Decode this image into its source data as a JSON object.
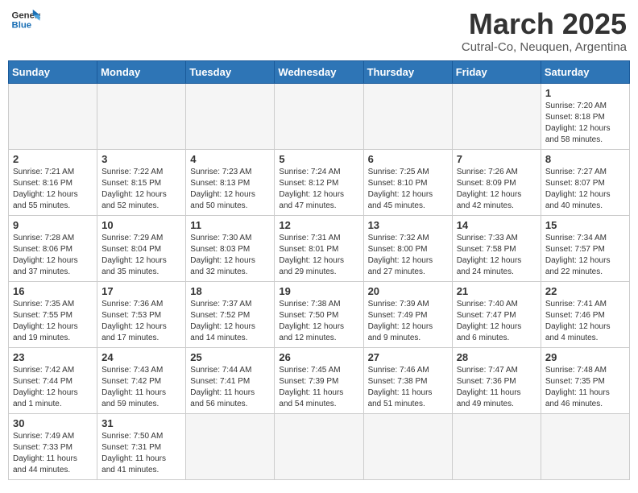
{
  "header": {
    "logo_general": "General",
    "logo_blue": "Blue",
    "main_title": "March 2025",
    "subtitle": "Cutral-Co, Neuquen, Argentina"
  },
  "weekdays": [
    "Sunday",
    "Monday",
    "Tuesday",
    "Wednesday",
    "Thursday",
    "Friday",
    "Saturday"
  ],
  "weeks": [
    [
      {
        "day": "",
        "info": ""
      },
      {
        "day": "",
        "info": ""
      },
      {
        "day": "",
        "info": ""
      },
      {
        "day": "",
        "info": ""
      },
      {
        "day": "",
        "info": ""
      },
      {
        "day": "",
        "info": ""
      },
      {
        "day": "1",
        "info": "Sunrise: 7:20 AM\nSunset: 8:18 PM\nDaylight: 12 hours\nand 58 minutes."
      }
    ],
    [
      {
        "day": "2",
        "info": "Sunrise: 7:21 AM\nSunset: 8:16 PM\nDaylight: 12 hours\nand 55 minutes."
      },
      {
        "day": "3",
        "info": "Sunrise: 7:22 AM\nSunset: 8:15 PM\nDaylight: 12 hours\nand 52 minutes."
      },
      {
        "day": "4",
        "info": "Sunrise: 7:23 AM\nSunset: 8:13 PM\nDaylight: 12 hours\nand 50 minutes."
      },
      {
        "day": "5",
        "info": "Sunrise: 7:24 AM\nSunset: 8:12 PM\nDaylight: 12 hours\nand 47 minutes."
      },
      {
        "day": "6",
        "info": "Sunrise: 7:25 AM\nSunset: 8:10 PM\nDaylight: 12 hours\nand 45 minutes."
      },
      {
        "day": "7",
        "info": "Sunrise: 7:26 AM\nSunset: 8:09 PM\nDaylight: 12 hours\nand 42 minutes."
      },
      {
        "day": "8",
        "info": "Sunrise: 7:27 AM\nSunset: 8:07 PM\nDaylight: 12 hours\nand 40 minutes."
      }
    ],
    [
      {
        "day": "9",
        "info": "Sunrise: 7:28 AM\nSunset: 8:06 PM\nDaylight: 12 hours\nand 37 minutes."
      },
      {
        "day": "10",
        "info": "Sunrise: 7:29 AM\nSunset: 8:04 PM\nDaylight: 12 hours\nand 35 minutes."
      },
      {
        "day": "11",
        "info": "Sunrise: 7:30 AM\nSunset: 8:03 PM\nDaylight: 12 hours\nand 32 minutes."
      },
      {
        "day": "12",
        "info": "Sunrise: 7:31 AM\nSunset: 8:01 PM\nDaylight: 12 hours\nand 29 minutes."
      },
      {
        "day": "13",
        "info": "Sunrise: 7:32 AM\nSunset: 8:00 PM\nDaylight: 12 hours\nand 27 minutes."
      },
      {
        "day": "14",
        "info": "Sunrise: 7:33 AM\nSunset: 7:58 PM\nDaylight: 12 hours\nand 24 minutes."
      },
      {
        "day": "15",
        "info": "Sunrise: 7:34 AM\nSunset: 7:57 PM\nDaylight: 12 hours\nand 22 minutes."
      }
    ],
    [
      {
        "day": "16",
        "info": "Sunrise: 7:35 AM\nSunset: 7:55 PM\nDaylight: 12 hours\nand 19 minutes."
      },
      {
        "day": "17",
        "info": "Sunrise: 7:36 AM\nSunset: 7:53 PM\nDaylight: 12 hours\nand 17 minutes."
      },
      {
        "day": "18",
        "info": "Sunrise: 7:37 AM\nSunset: 7:52 PM\nDaylight: 12 hours\nand 14 minutes."
      },
      {
        "day": "19",
        "info": "Sunrise: 7:38 AM\nSunset: 7:50 PM\nDaylight: 12 hours\nand 12 minutes."
      },
      {
        "day": "20",
        "info": "Sunrise: 7:39 AM\nSunset: 7:49 PM\nDaylight: 12 hours\nand 9 minutes."
      },
      {
        "day": "21",
        "info": "Sunrise: 7:40 AM\nSunset: 7:47 PM\nDaylight: 12 hours\nand 6 minutes."
      },
      {
        "day": "22",
        "info": "Sunrise: 7:41 AM\nSunset: 7:46 PM\nDaylight: 12 hours\nand 4 minutes."
      }
    ],
    [
      {
        "day": "23",
        "info": "Sunrise: 7:42 AM\nSunset: 7:44 PM\nDaylight: 12 hours\nand 1 minute."
      },
      {
        "day": "24",
        "info": "Sunrise: 7:43 AM\nSunset: 7:42 PM\nDaylight: 11 hours\nand 59 minutes."
      },
      {
        "day": "25",
        "info": "Sunrise: 7:44 AM\nSunset: 7:41 PM\nDaylight: 11 hours\nand 56 minutes."
      },
      {
        "day": "26",
        "info": "Sunrise: 7:45 AM\nSunset: 7:39 PM\nDaylight: 11 hours\nand 54 minutes."
      },
      {
        "day": "27",
        "info": "Sunrise: 7:46 AM\nSunset: 7:38 PM\nDaylight: 11 hours\nand 51 minutes."
      },
      {
        "day": "28",
        "info": "Sunrise: 7:47 AM\nSunset: 7:36 PM\nDaylight: 11 hours\nand 49 minutes."
      },
      {
        "day": "29",
        "info": "Sunrise: 7:48 AM\nSunset: 7:35 PM\nDaylight: 11 hours\nand 46 minutes."
      }
    ],
    [
      {
        "day": "30",
        "info": "Sunrise: 7:49 AM\nSunset: 7:33 PM\nDaylight: 11 hours\nand 44 minutes."
      },
      {
        "day": "31",
        "info": "Sunrise: 7:50 AM\nSunset: 7:31 PM\nDaylight: 11 hours\nand 41 minutes."
      },
      {
        "day": "",
        "info": ""
      },
      {
        "day": "",
        "info": ""
      },
      {
        "day": "",
        "info": ""
      },
      {
        "day": "",
        "info": ""
      },
      {
        "day": "",
        "info": ""
      }
    ]
  ]
}
